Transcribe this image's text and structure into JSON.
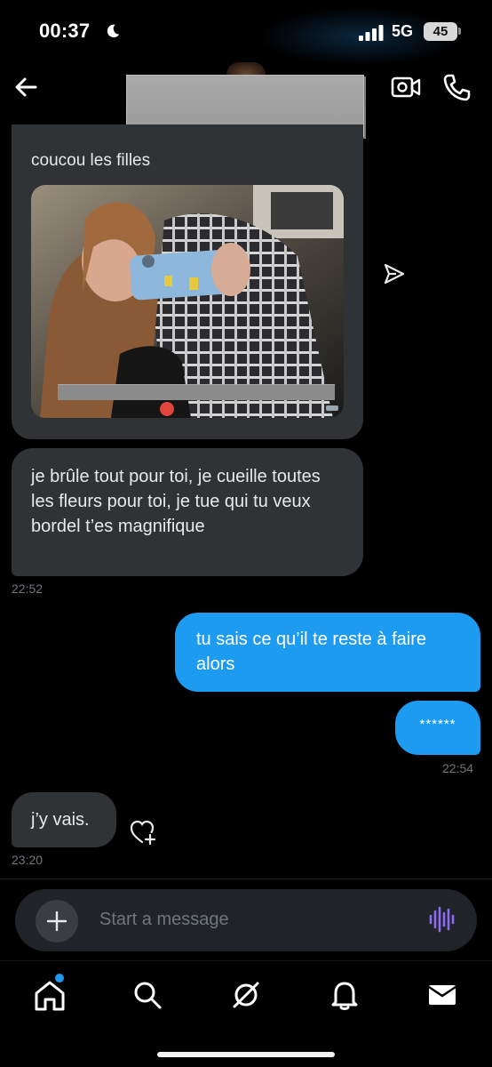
{
  "status_bar": {
    "time": "00:37",
    "network": "5G",
    "battery": "45",
    "icons": [
      "moon-icon",
      "signal-icon",
      "battery-icon"
    ]
  },
  "header": {
    "back_icon": "arrow-left-icon",
    "video_icon": "video-camera-icon",
    "call_icon": "phone-icon"
  },
  "messages": [
    {
      "direction": "incoming",
      "text": "coucou les filles",
      "has_photo": true
    },
    {
      "direction": "incoming",
      "text": "je brûle tout pour toi, je cueille toutes les fleurs pour toi, je tue qui tu veux bordel t’es magnifique",
      "time": "22:52"
    },
    {
      "direction": "outgoing",
      "text": "tu sais ce qu’il te reste à faire alors"
    },
    {
      "direction": "outgoing",
      "text": "******",
      "time": "22:54"
    },
    {
      "direction": "incoming",
      "text": "j’y vais.",
      "time": "23:20"
    }
  ],
  "composer": {
    "placeholder": "Start a message",
    "add_icon": "plus-icon",
    "voice_icon": "voice-wave-icon"
  },
  "tabs": [
    {
      "name": "home",
      "icon": "home-icon",
      "has_notification_dot": true
    },
    {
      "name": "search",
      "icon": "search-icon"
    },
    {
      "name": "grok",
      "icon": "grok-icon"
    },
    {
      "name": "notifications",
      "icon": "bell-icon"
    },
    {
      "name": "messages",
      "icon": "mail-icon"
    }
  ],
  "colors": {
    "background": "#000000",
    "incoming_bubble": "#2f3336",
    "outgoing_bubble": "#1d9bf0",
    "timestamp": "#71767b",
    "voice_accent": "#8c6cf2"
  }
}
